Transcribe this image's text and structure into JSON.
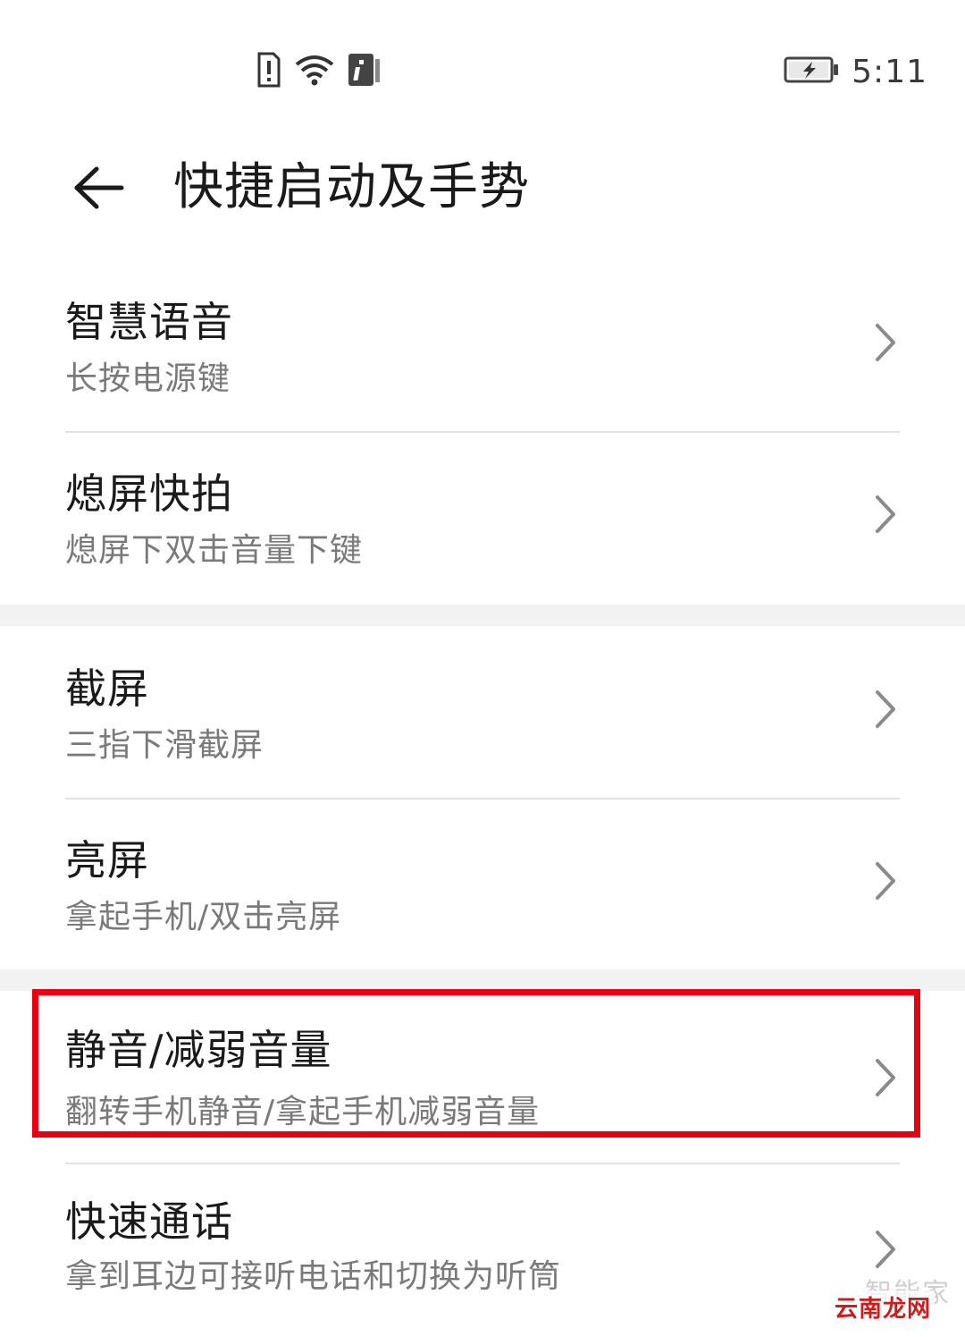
{
  "status_bar": {
    "time": "5:11",
    "icons": [
      "sim-alert-icon",
      "wifi-icon",
      "info-icon",
      "battery-charging-icon"
    ]
  },
  "app_bar": {
    "title": "快捷启动及手势",
    "back_icon": "back-arrow-icon"
  },
  "groups": [
    {
      "items": [
        {
          "title": "智慧语音",
          "subtitle": "长按电源键"
        },
        {
          "title": "熄屏快拍",
          "subtitle": "熄屏下双击音量下键"
        }
      ]
    },
    {
      "items": [
        {
          "title": "截屏",
          "subtitle": "三指下滑截屏"
        },
        {
          "title": "亮屏",
          "subtitle": "拿起手机/双击亮屏"
        }
      ]
    },
    {
      "items": [
        {
          "title": "静音/减弱音量",
          "subtitle": "翻转手机静音/拿起手机减弱音量"
        },
        {
          "title": "快速通话",
          "subtitle": "拿到耳边可接听电话和切换为听筒"
        }
      ]
    }
  ],
  "watermark": {
    "top": "智能家",
    "bottom": "云南龙网"
  },
  "colors": {
    "highlight": "#e60012",
    "subtitle": "#7a7a7a",
    "separator_band": "#f2f2f2"
  }
}
